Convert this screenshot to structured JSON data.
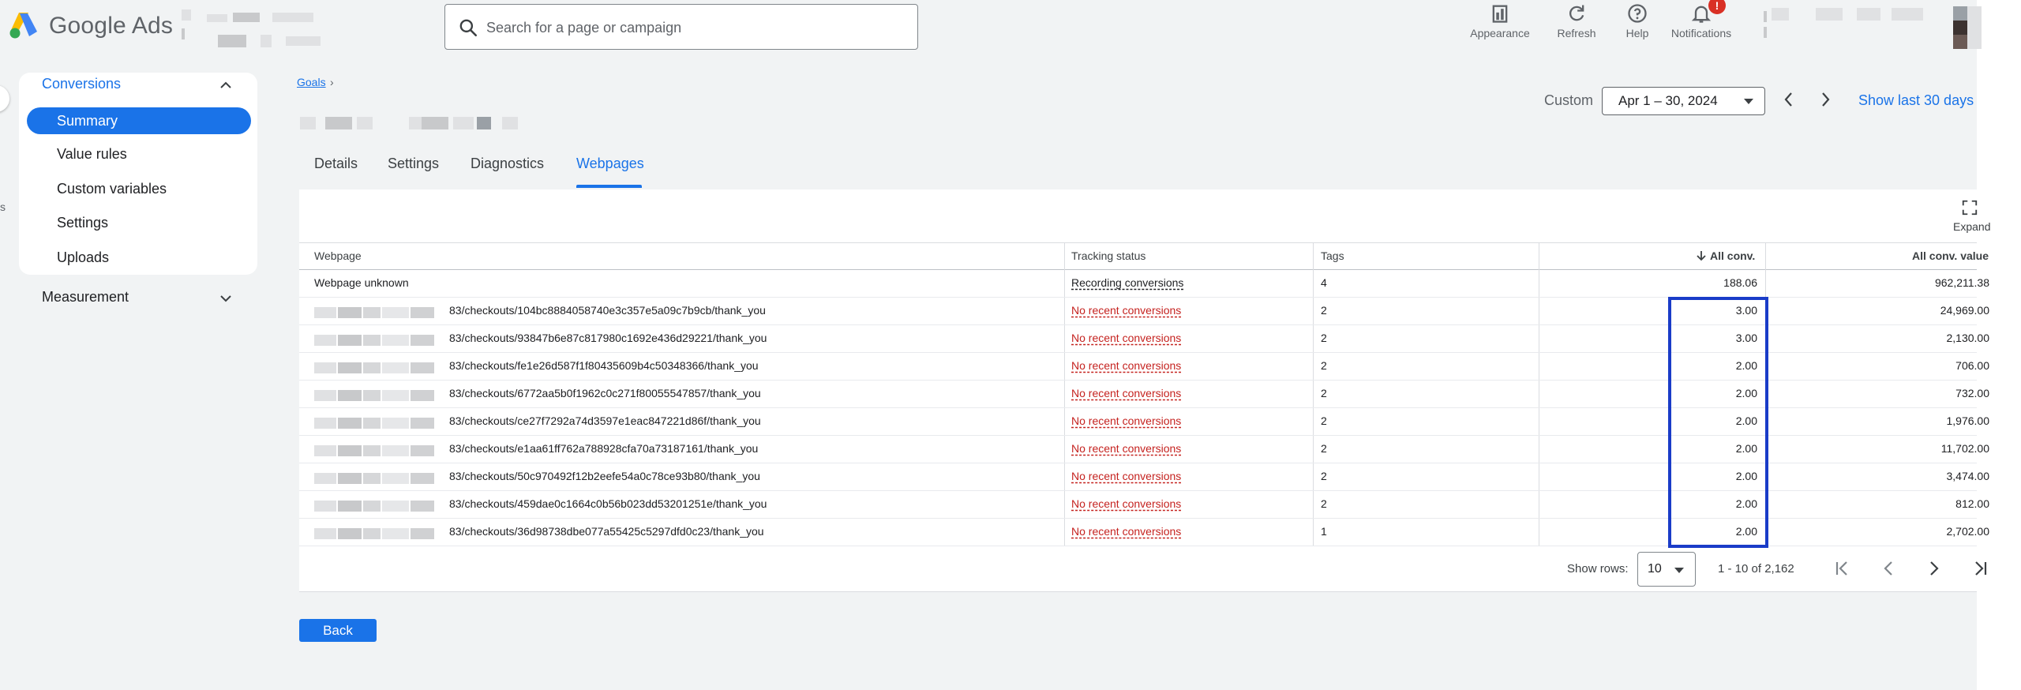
{
  "app": {
    "name": "Google Ads"
  },
  "search": {
    "placeholder": "Search for a page or campaign"
  },
  "toolbar": {
    "appearance": "Appearance",
    "refresh": "Refresh",
    "help": "Help",
    "notifications": "Notifications",
    "notification_badge": "!"
  },
  "sidebar": {
    "section": "Conversions",
    "items": [
      {
        "label": "Summary",
        "active": true
      },
      {
        "label": "Value rules"
      },
      {
        "label": "Custom variables"
      },
      {
        "label": "Settings"
      },
      {
        "label": "Uploads"
      }
    ],
    "measurement": "Measurement",
    "edge_letter": "s"
  },
  "breadcrumb": {
    "goals": "Goals",
    "sep": "›"
  },
  "date": {
    "custom_label": "Custom",
    "range": "Apr 1 – 30, 2024",
    "show_last": "Show last 30 days"
  },
  "tabs": [
    "Details",
    "Settings",
    "Diagnostics",
    "Webpages"
  ],
  "active_tab": "Webpages",
  "table": {
    "expand_label": "Expand",
    "headers": {
      "webpage": "Webpage",
      "tracking": "Tracking status",
      "tags": "Tags",
      "all_conv": "All conv.",
      "all_conv_value": "All conv. value"
    },
    "rows": [
      {
        "webpage": "Webpage unknown",
        "tracking": "Recording conversions",
        "tags": "4",
        "all_conv": "188.06",
        "value": "962,211.38"
      },
      {
        "webpage": "83/checkouts/104bc8884058740e3c357e5a09c7b9cb/thank_you",
        "tracking": "No recent conversions",
        "tags": "2",
        "all_conv": "3.00",
        "value": "24,969.00"
      },
      {
        "webpage": "83/checkouts/93847b6e87c817980c1692e436d29221/thank_you",
        "tracking": "No recent conversions",
        "tags": "2",
        "all_conv": "3.00",
        "value": "2,130.00"
      },
      {
        "webpage": "83/checkouts/fe1e26d587f1f80435609b4c50348366/thank_you",
        "tracking": "No recent conversions",
        "tags": "2",
        "all_conv": "2.00",
        "value": "706.00"
      },
      {
        "webpage": "83/checkouts/6772aa5b0f1962c0c271f80055547857/thank_you",
        "tracking": "No recent conversions",
        "tags": "2",
        "all_conv": "2.00",
        "value": "732.00"
      },
      {
        "webpage": "83/checkouts/ce27f7292a74d3597e1eac847221d86f/thank_you",
        "tracking": "No recent conversions",
        "tags": "2",
        "all_conv": "2.00",
        "value": "1,976.00"
      },
      {
        "webpage": "83/checkouts/e1aa61ff762a788928cfa70a73187161/thank_you",
        "tracking": "No recent conversions",
        "tags": "2",
        "all_conv": "2.00",
        "value": "11,702.00"
      },
      {
        "webpage": "83/checkouts/50c970492f12b2eefe54a0c78ce93b80/thank_you",
        "tracking": "No recent conversions",
        "tags": "2",
        "all_conv": "2.00",
        "value": "3,474.00"
      },
      {
        "webpage": "83/checkouts/459dae0c1664c0b56b023dd53201251e/thank_you",
        "tracking": "No recent conversions",
        "tags": "2",
        "all_conv": "2.00",
        "value": "812.00"
      },
      {
        "webpage": "83/checkouts/36d98738dbe077a55425c5297dfd0c23/thank_you",
        "tracking": "No recent conversions",
        "tags": "1",
        "all_conv": "2.00",
        "value": "2,702.00"
      }
    ]
  },
  "pagination": {
    "show_rows_label": "Show rows:",
    "rows_value": "10",
    "range": "1 - 10 of 2,162"
  },
  "back_label": "Back",
  "colors": {
    "accent": "#1a73e8",
    "error": "#c5221f",
    "highlight": "#1a3cc8"
  }
}
